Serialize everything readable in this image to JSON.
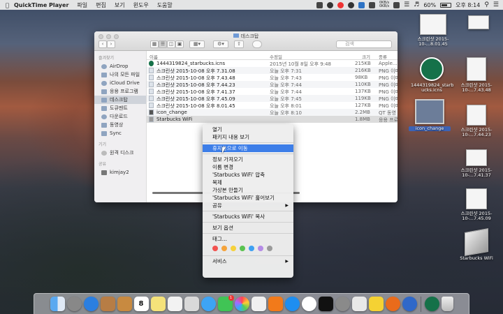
{
  "menubar": {
    "app_name": "QuickTime Player",
    "menus": [
      "파일",
      "편집",
      "보기",
      "윈도우",
      "도움말"
    ],
    "battery": "60%",
    "clock": "오후 8:14",
    "net_speed": [
      "0KB/s",
      "0KB/s"
    ]
  },
  "finder": {
    "title": "데스크탑",
    "search_placeholder": "검색",
    "sidebar": {
      "favorites_header": "즐겨찾기",
      "favorites": [
        {
          "label": "AirDrop"
        },
        {
          "label": "나의 모든 파일"
        },
        {
          "label": "iCloud Drive"
        },
        {
          "label": "응용 프로그램"
        },
        {
          "label": "데스크탑"
        },
        {
          "label": "도큐멘트"
        },
        {
          "label": "다운로드"
        },
        {
          "label": "동영상"
        },
        {
          "label": "Sync"
        }
      ],
      "devices_header": "기기",
      "devices": [
        {
          "label": "원격 디스크"
        }
      ],
      "shared_header": "공유",
      "shared": [
        {
          "label": "kimjay2"
        }
      ]
    },
    "columns": {
      "name": "이름",
      "modified": "수정일",
      "size": "크기",
      "kind": "종류"
    },
    "files": [
      {
        "name": "1444319824_starbucks.icns",
        "modified": "2015년 10월 8일 오후 9:48",
        "size": "215KB",
        "kind": "Apple..."
      },
      {
        "name": "스크린샷 2015-10-08 오후 7.31.08",
        "modified": "오늘 오후 7:31",
        "size": "216KB",
        "kind": "PNG 이미"
      },
      {
        "name": "스크린샷 2015-10-08 오후 7.43.48",
        "modified": "오늘 오후 7:43",
        "size": "98KB",
        "kind": "PNG 이미"
      },
      {
        "name": "스크린샷 2015-10-08 오후 7.44.23",
        "modified": "오늘 오후 7:44",
        "size": "110KB",
        "kind": "PNG 이미"
      },
      {
        "name": "스크린샷 2015-10-08 오후 7.41.37",
        "modified": "오늘 오후 7:44",
        "size": "137KB",
        "kind": "PNG 이미"
      },
      {
        "name": "스크린샷 2015-10-08 오후 7.45.09",
        "modified": "오늘 오후 7:45",
        "size": "119KB",
        "kind": "PNG 이미"
      },
      {
        "name": "스크린샷 2015-10-08 오후 8.01.45",
        "modified": "오늘 오후 8:01",
        "size": "127KB",
        "kind": "PNG 이미"
      },
      {
        "name": "icon_change",
        "modified": "오늘 오후 8:10",
        "size": "2.2MB",
        "kind": "QT 동영"
      },
      {
        "name": "Starbucks WiFi",
        "modified": "",
        "size": "1.8MB",
        "kind": "응용 프로"
      }
    ]
  },
  "context_menu": {
    "group1": [
      "열기",
      "패키지 내용 보기"
    ],
    "group2": [
      "휴지통으로 이동"
    ],
    "group3": [
      "정보 가져오기",
      "이름 변경",
      "'Starbucks WiFi' 압축",
      "복제",
      "가상본 만들기",
      "'Starbucks WiFi' 훑어보기",
      "공유"
    ],
    "group4": [
      "'Starbucks WiFi' 복사"
    ],
    "group5": [
      "보기 옵션"
    ],
    "group6": [
      "태그..."
    ],
    "services": "서비스",
    "tag_colors": [
      "#f2524f",
      "#f5a33a",
      "#f6d13b",
      "#5ac351",
      "#3ea0f2",
      "#b58be6",
      "#9a9a9a"
    ]
  },
  "desktop": {
    "icons": [
      {
        "label": "스크린샷 2015-10-...8.01.45"
      },
      {
        "label": "1444319824_starb ucks.icns"
      },
      {
        "label": "스크린샷 2015-10-...7.43.48"
      },
      {
        "label": "icon_change"
      },
      {
        "label": "스크린샷 2015-10-...7.44.23"
      },
      {
        "label": "스크린샷 2015-10-...7.41.37"
      },
      {
        "label": "스크린샷 2015-10-...7.45.09"
      },
      {
        "label": "Starbucks WiFi"
      }
    ]
  },
  "dock": {
    "calendar_day": "8",
    "badge": "1"
  }
}
